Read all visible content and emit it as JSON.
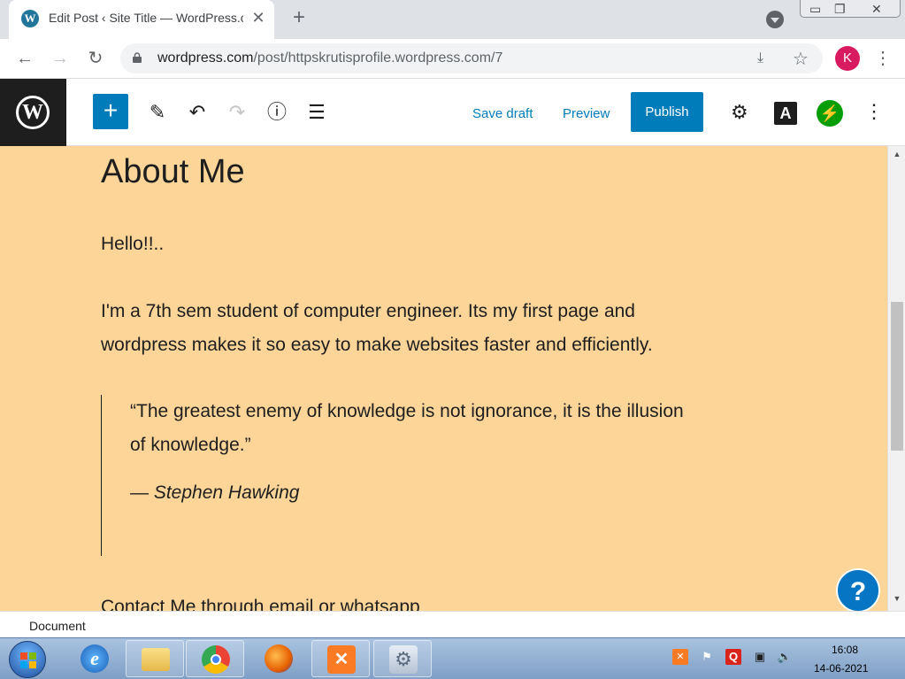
{
  "browser": {
    "tab_title": "Edit Post ‹ Site Title — WordPress.com",
    "tab_close": "✕",
    "new_tab": "+",
    "url_host": "wordpress.com",
    "url_path": "/post/httpskrutisprofile.wordpress.com/7",
    "profile_initial": "K"
  },
  "editor": {
    "save_draft_label": "Save draft",
    "preview_label": "Preview",
    "publish_label": "Publish",
    "styles_label": "A"
  },
  "post": {
    "title": "About Me",
    "para1": "Hello!!..",
    "para2_line1": "I'm a 7th sem student of computer engineer. Its my first page and",
    "para2_line2": "wordpress makes it  so easy to make websites faster and efficiently.",
    "quote_line1": "“The greatest enemy of knowledge is not ignorance, it is the illusion",
    "quote_line2": "of knowledge.”",
    "quote_cite": "— Stephen Hawking",
    "para3": "Contact Me through email or whatsapp"
  },
  "footer": {
    "breadcrumb": "Document"
  },
  "help": {
    "label": "?"
  },
  "taskbar": {
    "time": "16:08",
    "date": "14-06-2021"
  },
  "colors": {
    "canvas_bg": "#fdd598",
    "wp_blue": "#007cba",
    "jetpack_green": "#069e08",
    "profile_pink": "#d81b60"
  }
}
